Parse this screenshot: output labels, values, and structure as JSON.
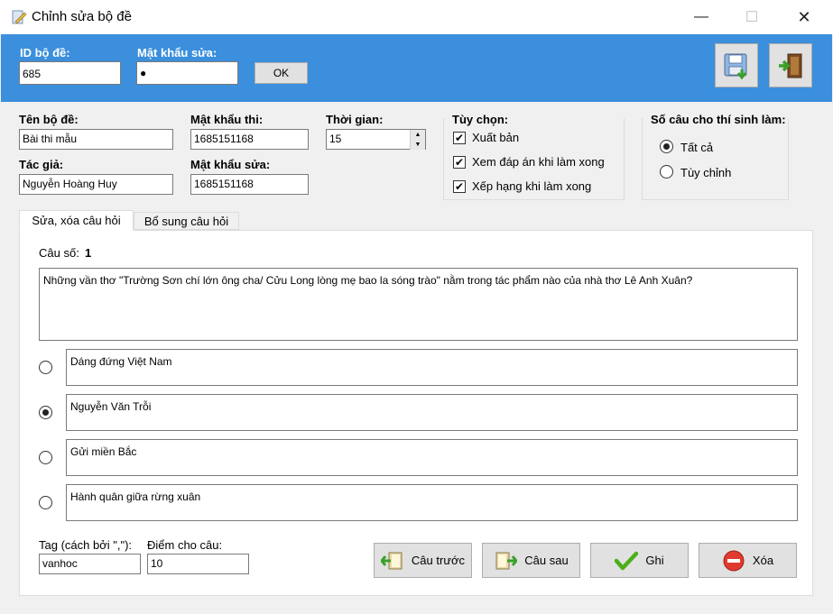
{
  "window": {
    "title": "Chỉnh sửa bộ đề",
    "minimize": "—",
    "maximize": "☐",
    "close": "✕"
  },
  "header": {
    "id_label": "ID bộ đề:",
    "id_value": "685",
    "password_label": "Mật khẩu sửa:",
    "password_value": "●",
    "ok_label": "OK"
  },
  "form": {
    "name_label": "Tên bộ đề:",
    "name_value": "Bài thi mẫu",
    "author_label": "Tác giả:",
    "author_value": "Nguyễn Hoàng Huy",
    "exam_password_label": "Mật khẩu thi:",
    "exam_password_value": "1685151168",
    "edit_password_label": "Mật khẩu sửa:",
    "edit_password_value": "1685151168",
    "time_label": "Thời gian:",
    "time_value": "15"
  },
  "options": {
    "label": "Tùy chọn:",
    "items": [
      {
        "label": "Xuất bản",
        "checked": true
      },
      {
        "label": "Xem đáp án khi làm xong",
        "checked": true
      },
      {
        "label": "Xếp hạng khi làm xong",
        "checked": true
      }
    ]
  },
  "question_count": {
    "label": "Số câu cho thí sinh làm:",
    "items": [
      {
        "label": "Tất cả",
        "selected": true
      },
      {
        "label": "Tùy chỉnh",
        "selected": false
      }
    ]
  },
  "tabs": [
    {
      "label": "Sửa, xóa câu hỏi",
      "active": true
    },
    {
      "label": "Bổ sung câu hỏi",
      "active": false
    }
  ],
  "question": {
    "number_label": "Câu số:",
    "number_value": "1",
    "text": "Những vần thơ \"Trường Sơn chí lớn ông cha/ Cửu Long lòng mẹ bao la sóng trào\" nằm trong tác phẩm nào của nhà thơ Lê Anh Xuân?",
    "answers": [
      {
        "text": "Dáng đứng Việt Nam",
        "selected": false
      },
      {
        "text": "Nguyễn Văn Trỗi",
        "selected": true
      },
      {
        "text": "Gửi miền Bắc",
        "selected": false
      },
      {
        "text": "Hành quân giữa rừng xuân",
        "selected": false
      }
    ]
  },
  "footer": {
    "tag_label": "Tag (cách bởi \",\"):",
    "tag_value": "vanhoc",
    "score_label": "Điểm cho câu:",
    "score_value": "10",
    "prev_label": "Câu trước",
    "next_label": "Câu sau",
    "save_label": "Ghi",
    "delete_label": "Xóa"
  },
  "colors": {
    "header_blue": "#3b8fdc",
    "save_check": "#4caf1a",
    "delete_red": "#e03a2f"
  }
}
